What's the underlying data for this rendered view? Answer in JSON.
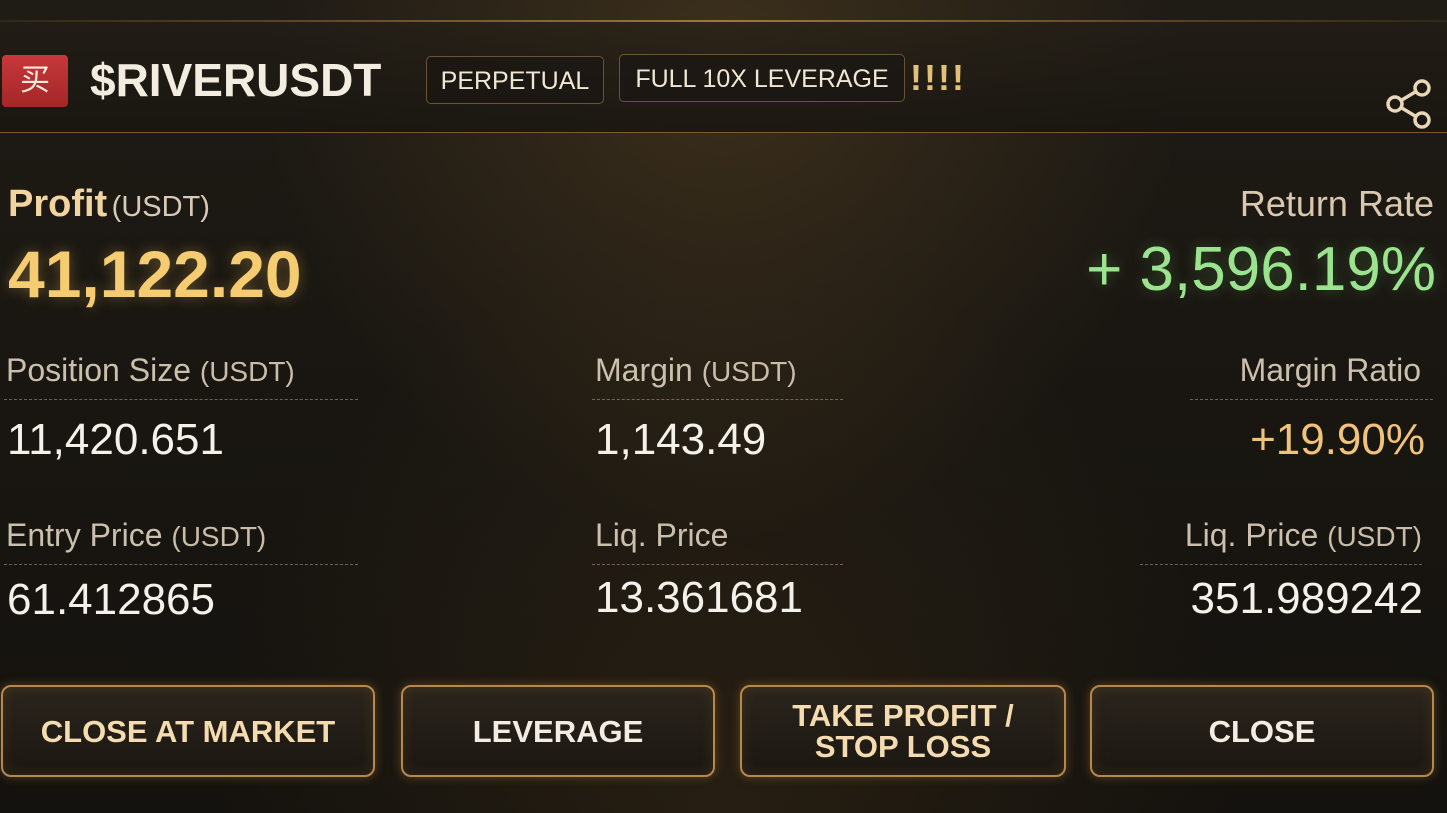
{
  "header": {
    "buy_badge": "买",
    "symbol": "$RIVERUSDT",
    "tags": [
      "PERPETUAL",
      "FULL 10X LEVERAGE"
    ],
    "exclamation": "!!!!",
    "share_icon": "share-icon"
  },
  "profit": {
    "label": "Profit",
    "unit": "(USDT)",
    "value": "41,122.20"
  },
  "return_rate": {
    "label": "Return Rate",
    "value": "+ 3,596.19%"
  },
  "stats": {
    "position_size": {
      "label": "Position Size",
      "unit": "(USDT)",
      "value": "11,420.651"
    },
    "margin": {
      "label": "Margin",
      "unit": "(USDT)",
      "value": "1,143.49"
    },
    "margin_ratio": {
      "label": "Margin Ratio",
      "value": "+19.90%"
    },
    "entry_price": {
      "label": "Entry Price",
      "unit": "(USDT)",
      "value": "61.412865"
    },
    "liq_price": {
      "label": "Liq. Price",
      "value": "13.361681"
    },
    "liq_price_usdt": {
      "label": "Liq. Price",
      "unit": "(USDT)",
      "value": "351.989242"
    }
  },
  "buttons": {
    "close_at_market": "CLOSE AT MARKET",
    "leverage": "LEVERAGE",
    "tpsl_line1": "TAKE PROFIT /",
    "tpsl_line2": "STOP LOSS",
    "close": "CLOSE"
  },
  "colors": {
    "profit": "#f5cc72",
    "return_rate": "#9be38f",
    "margin_ratio": "#f0c27a",
    "button_border": "#b8874a",
    "buy_badge": "#c7383a"
  }
}
